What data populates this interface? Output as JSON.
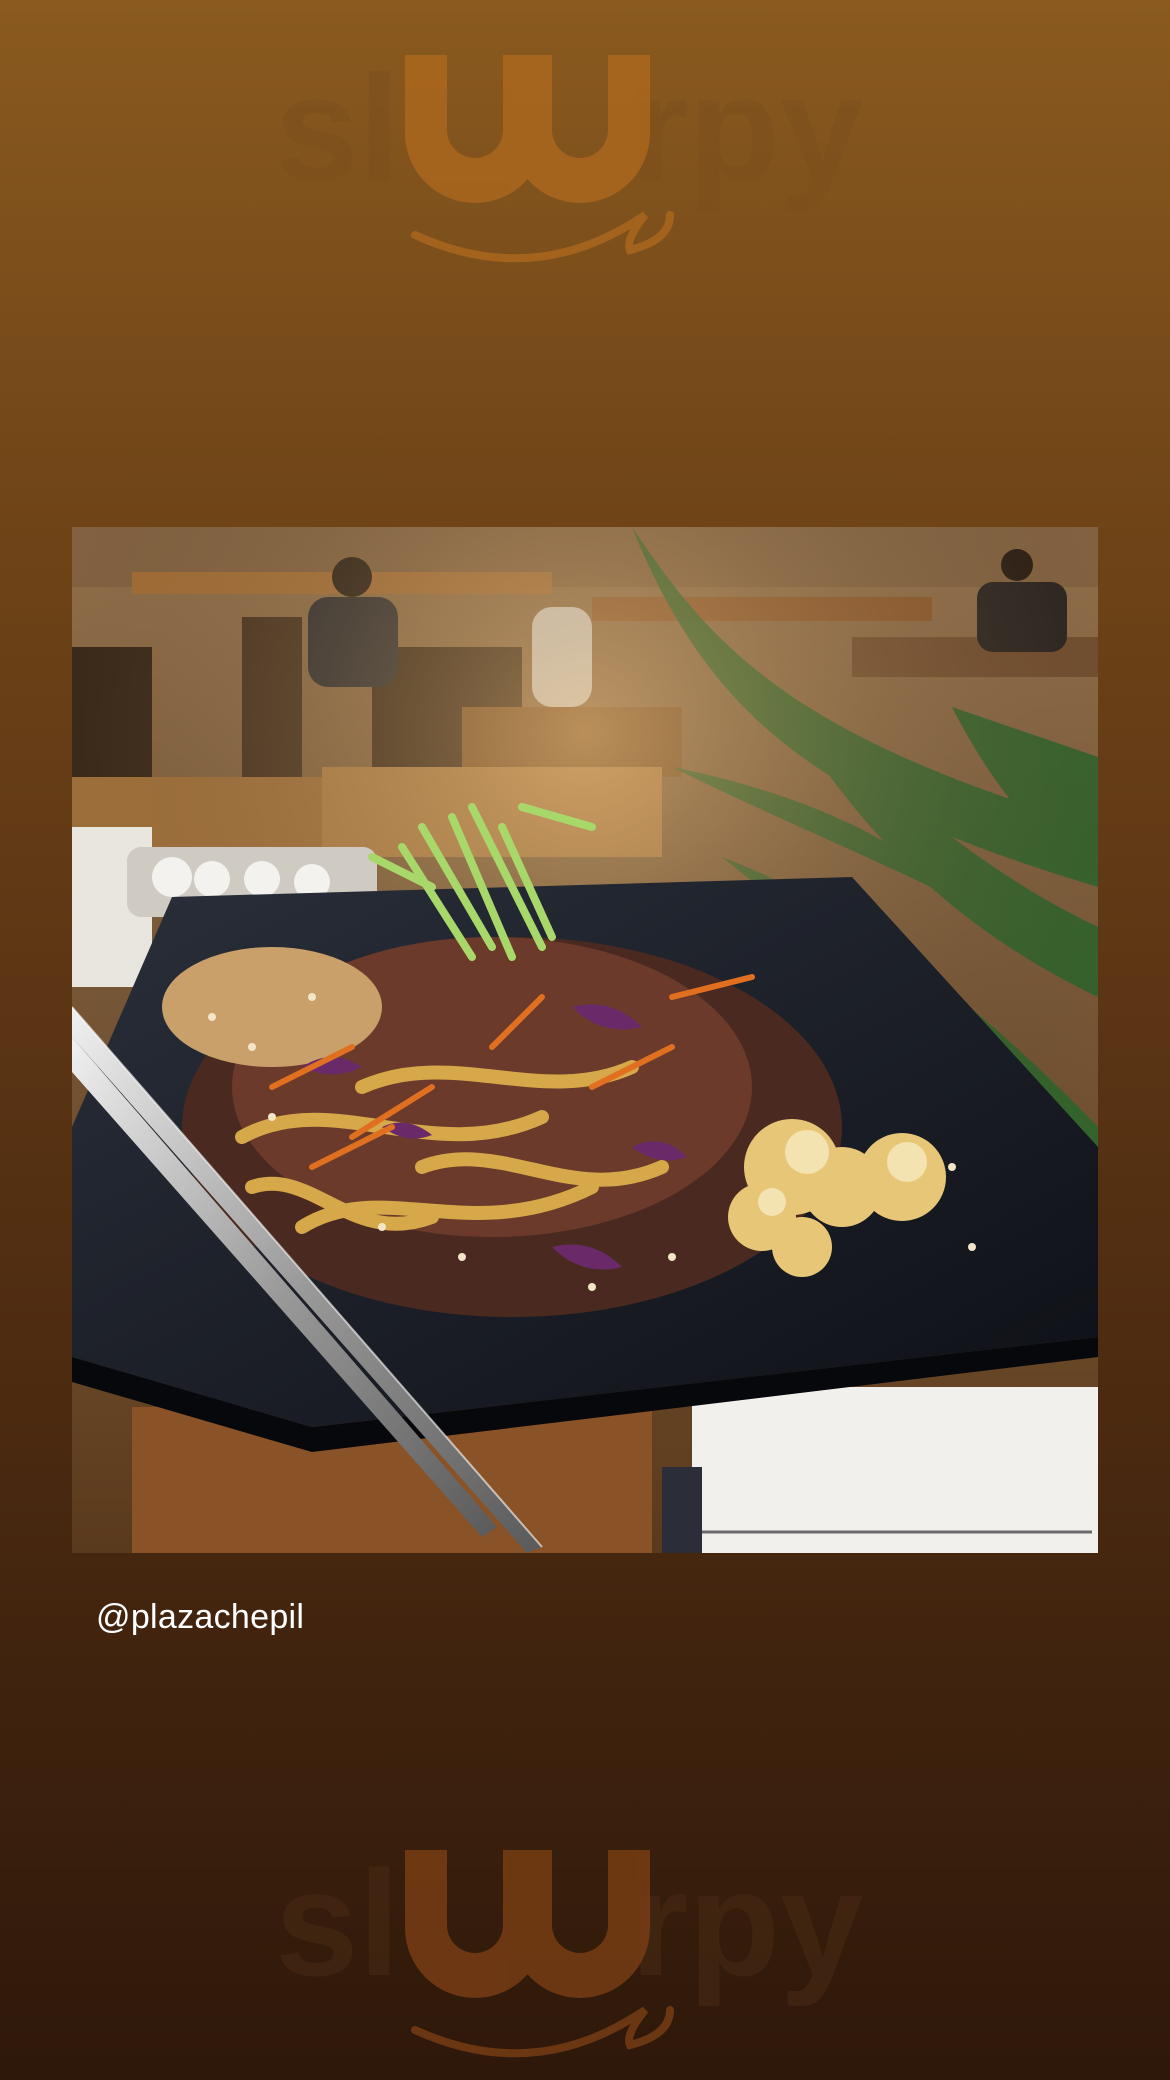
{
  "watermark": {
    "brand": "sluurpy",
    "icon": "sluurpy-logo"
  },
  "story": {
    "photo_icon": "food-photo-noodles-stir-fry",
    "handle": "@plazachepil"
  },
  "colors": {
    "background_top": "#8a5a1f",
    "background_bottom": "#2e180a",
    "watermark": "#a06a28",
    "handle_text": "#ffffff"
  }
}
